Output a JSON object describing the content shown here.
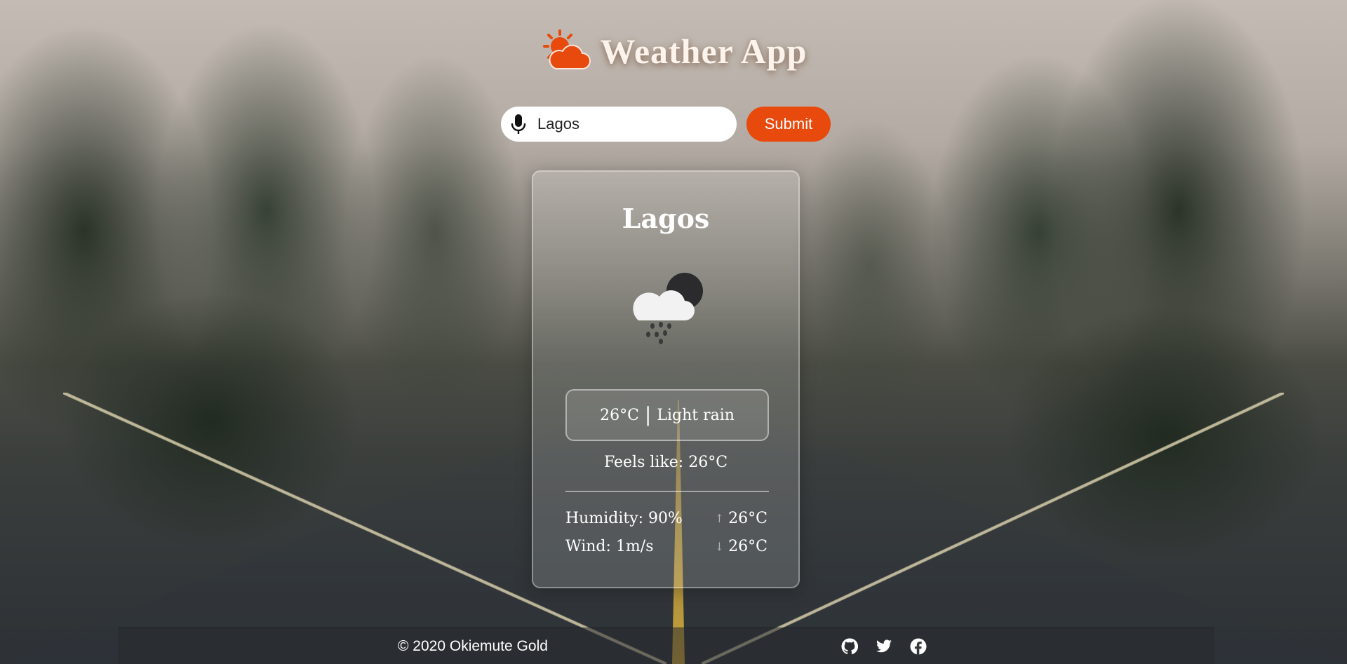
{
  "app": {
    "title": "Weather App",
    "logo_icon": "sun-behind-cloud-icon",
    "accent_color": "#e8490c"
  },
  "search": {
    "value": "Lagos",
    "placeholder": "",
    "mic_icon": "microphone-icon",
    "submit_label": "Submit"
  },
  "weather": {
    "city": "Lagos",
    "icon": "cloud-rain-night-icon",
    "temperature": "26°C",
    "separator": "|",
    "condition": "Light rain",
    "feels_like": "Feels like: 26°C",
    "humidity": "Humidity: 90%",
    "wind": "Wind: 1m/s",
    "temp_max": "26°C",
    "temp_min": "26°C"
  },
  "footer": {
    "copyright": "© 2020 Okiemute Gold",
    "social": [
      "github-icon",
      "twitter-icon",
      "facebook-icon"
    ]
  }
}
